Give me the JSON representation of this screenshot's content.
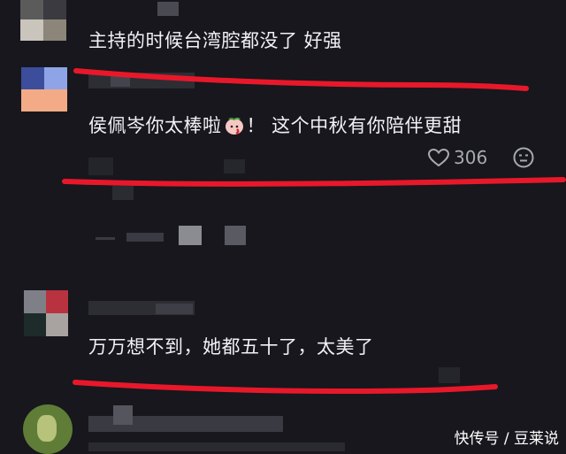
{
  "comments": [
    {
      "text": "主持的时候台湾腔都没了 好强"
    },
    {
      "text": "侯佩岑你太棒啦",
      "text_after_emoji": "！ 这个中秋有你陪伴更甜",
      "like_count": "306"
    },
    {
      "text": "万万想不到，她都五十了，太美了"
    }
  ],
  "watermark": "快传号 / 豆莱说",
  "colors": {
    "background": "#17171d",
    "text": "#f2f2f5",
    "meta": "#a9a9b3",
    "underline": "#e8182a"
  },
  "icons": [
    "heart-outline-icon",
    "emoji-neutral-icon",
    "peach-emoji-icon"
  ]
}
